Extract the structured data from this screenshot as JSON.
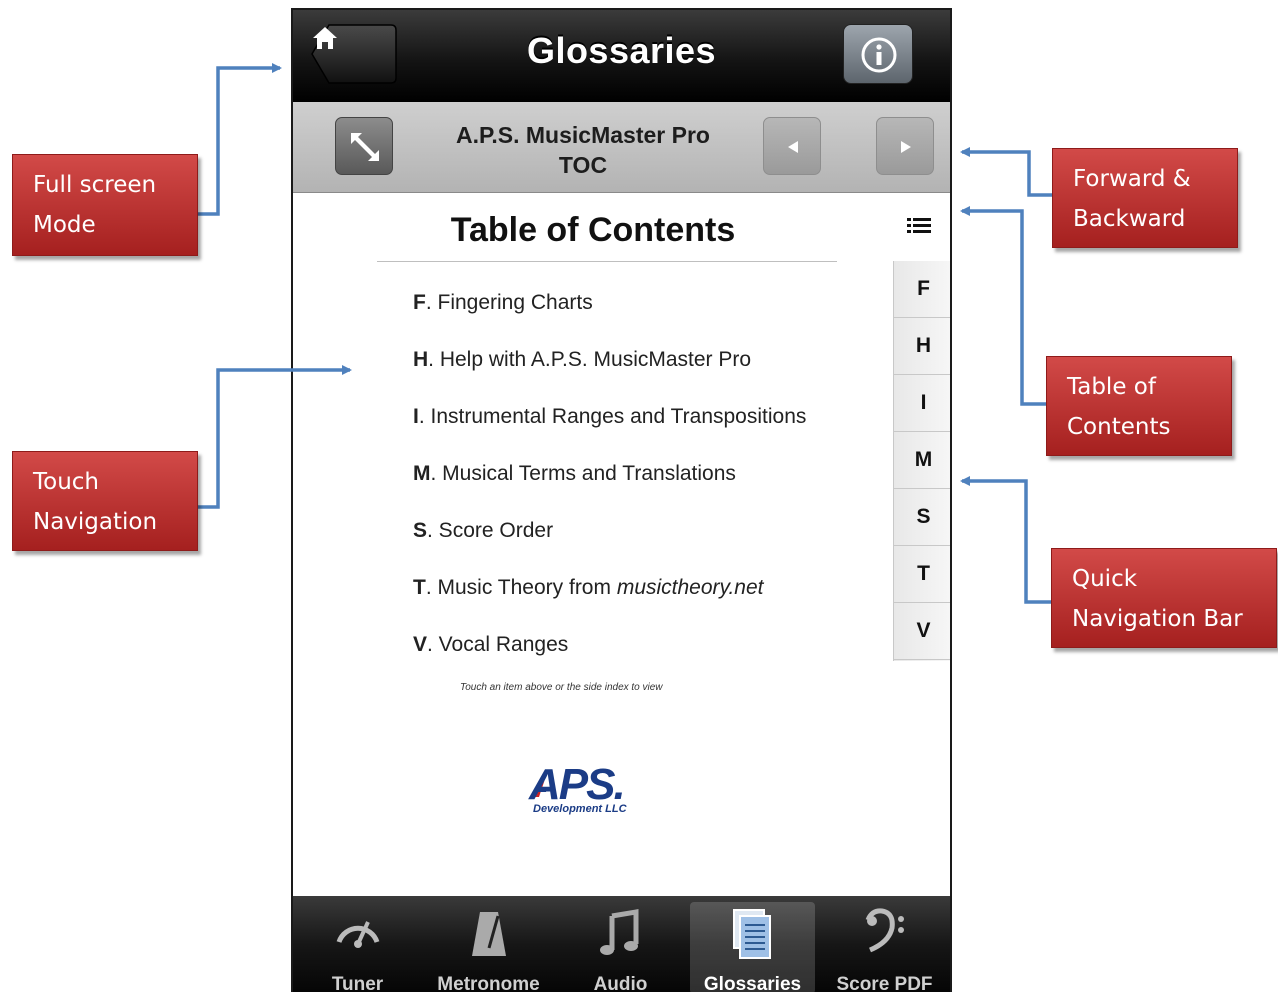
{
  "navbar": {
    "title": "Glossaries",
    "home_icon": "home-icon",
    "info_icon": "info-icon"
  },
  "subbar": {
    "title_line1": "A.P.S. MusicMaster Pro",
    "title_line2": "TOC",
    "fullscreen_icon": "expand-icon",
    "back_icon": "triangle-left-icon",
    "forward_icon": "triangle-right-icon"
  },
  "toc": {
    "heading": "Table of Contents",
    "items": [
      {
        "letter": "F",
        "text": ". Fingering Charts"
      },
      {
        "letter": "H",
        "text": ". Help with A.P.S. MusicMaster Pro"
      },
      {
        "letter": "I",
        "text": ". Instrumental Ranges and Transpositions"
      },
      {
        "letter": "M",
        "text": ". Musical Terms and Translations"
      },
      {
        "letter": "S",
        "text": ". Score Order"
      },
      {
        "letter": "T",
        "text": ". Music Theory from ",
        "italic": "musictheory.net"
      },
      {
        "letter": "V",
        "text": ". Vocal Ranges"
      }
    ],
    "hint": "Touch an item above or the side index to view"
  },
  "logo": {
    "text": "APS.",
    "sub": "Development LLC"
  },
  "index_bar": [
    "F",
    "H",
    "I",
    "M",
    "S",
    "T",
    "V"
  ],
  "tabs": [
    {
      "label": "Tuner",
      "icon": "gauge-icon"
    },
    {
      "label": "Metronome",
      "icon": "metronome-icon"
    },
    {
      "label": "Audio",
      "icon": "music-note-icon"
    },
    {
      "label": "Glossaries",
      "icon": "documents-icon",
      "active": true
    },
    {
      "label": "Score PDF",
      "icon": "bass-clef-icon"
    }
  ],
  "callouts": {
    "fullscreen": [
      "Full screen",
      "Mode"
    ],
    "touch": [
      "Touch",
      "Navigation"
    ],
    "forward_backward": [
      "Forward &",
      "Backward"
    ],
    "toc": [
      "Table of",
      "Contents"
    ],
    "quick": [
      "Quick",
      "Navigation Bar"
    ]
  },
  "colors": {
    "callout": "#b82a28",
    "arrow": "#4f81bd",
    "navbar": "#141414",
    "logo": "#1b3c86"
  }
}
